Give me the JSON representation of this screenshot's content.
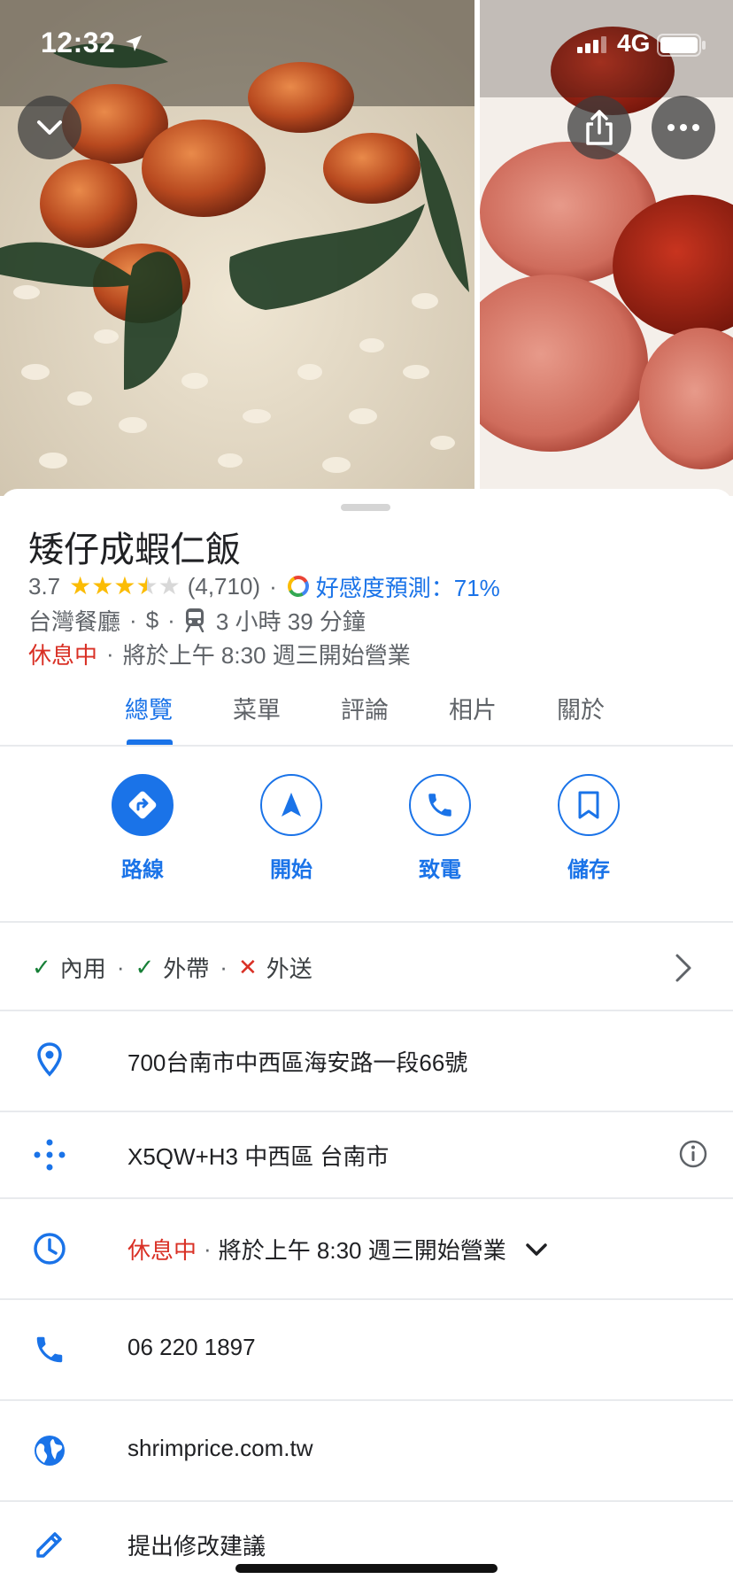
{
  "status_bar": {
    "time": "12:32",
    "network": "4G"
  },
  "photo_buttons": {
    "collapse_icon": "chevron-down-icon",
    "share_icon": "share-icon",
    "more_icon": "more-horizontal-icon"
  },
  "place": {
    "name": "矮仔成蝦仁飯",
    "rating": "3.7",
    "rating_value": 3.7,
    "review_count": "(4,710)",
    "match_label": "好感度預測：71%",
    "category": "台灣餐廳",
    "price": "$",
    "transit_time": "3 小時 39 分鐘",
    "status": "休息中",
    "opens": "將於上午 8:30 週三開始營業"
  },
  "tabs": [
    {
      "label": "總覽",
      "active": true
    },
    {
      "label": "菜單",
      "active": false
    },
    {
      "label": "評論",
      "active": false
    },
    {
      "label": "相片",
      "active": false
    },
    {
      "label": "關於",
      "active": false
    }
  ],
  "actions": [
    {
      "label": "路線",
      "icon": "directions-icon"
    },
    {
      "label": "開始",
      "icon": "navigation-icon"
    },
    {
      "label": "致電",
      "icon": "phone-icon"
    },
    {
      "label": "儲存",
      "icon": "bookmark-icon"
    }
  ],
  "services": [
    {
      "label": "內用",
      "available": true
    },
    {
      "label": "外帶",
      "available": true
    },
    {
      "label": "外送",
      "available": false
    }
  ],
  "info": {
    "address": "700台南市中西區海安路一段66號",
    "plus_code": "X5QW+H3 中西區 台南市",
    "hours_status": "休息中",
    "hours_detail": "將於上午 8:30 週三開始營業",
    "phone": "06 220 1897",
    "website": "shrimprice.com.tw",
    "suggest_edit": "提出修改建議"
  },
  "colors": {
    "accent": "#1a73e8",
    "closed": "#d93025",
    "star": "#fbbc04",
    "check": "#188038"
  }
}
